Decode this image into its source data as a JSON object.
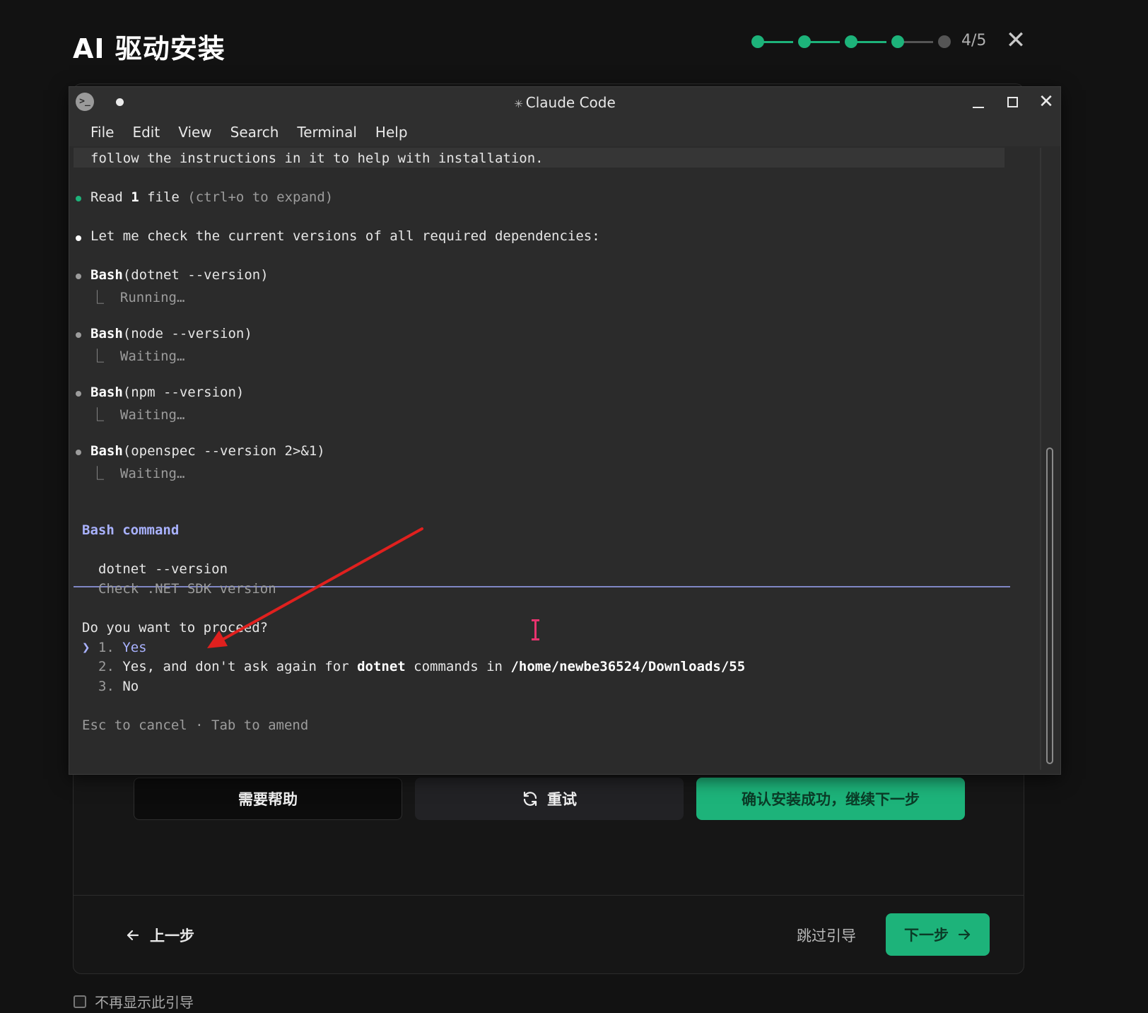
{
  "header": {
    "title": "AI 驱动安装",
    "step_counter": "4/5",
    "steps": [
      {
        "state": "done"
      },
      {
        "state": "done"
      },
      {
        "state": "done"
      },
      {
        "state": "current"
      },
      {
        "state": "pending"
      }
    ],
    "close_icon": "close-icon"
  },
  "terminal": {
    "window_title": "Claude Code",
    "menu": [
      "File",
      "Edit",
      "View",
      "Search",
      "Terminal",
      "Help"
    ],
    "lines": {
      "intro": "follow the instructions in it to help with installation.",
      "read_prefix": "Read ",
      "read_count": "1",
      "read_suffix": " file ",
      "read_hint": "(ctrl+o to expand)",
      "check": "Let me check the current versions of all required dependencies:",
      "bash_label": "Bash",
      "cmd1": "(dotnet --version)",
      "cmd1_status": "Running…",
      "cmd2": "(node --version)",
      "cmd2_status": "Waiting…",
      "cmd3": "(npm --version)",
      "cmd3_status": "Waiting…",
      "cmd4": "(openspec --version 2>&1)",
      "cmd4_status": "Waiting…"
    },
    "prompt": {
      "heading": "Bash command",
      "command": "dotnet --version",
      "description": "Check .NET SDK version",
      "question": "Do you want to proceed?",
      "selector": "❯",
      "option1_num": "1.",
      "option1": "Yes",
      "option2_num": "2.",
      "option2_a": "Yes, and don't ask again for ",
      "option2_cmd": "dotnet",
      "option2_b": " commands in ",
      "option2_path": "/home/newbe36524/Downloads/55",
      "option3_num": "3.",
      "option3": "No",
      "footer": "Esc to cancel · Tab to amend"
    }
  },
  "actions": {
    "help": "需要帮助",
    "retry": "重试",
    "confirm": "确认安装成功，继续下一步"
  },
  "footer": {
    "prev": "上一步",
    "skip": "跳过引导",
    "next": "下一步",
    "dont_show": "不再显示此引导"
  },
  "colors": {
    "accent": "#1db37a",
    "step_done": "#1db37a",
    "step_pending": "#555555",
    "prompt_purple": "#a9b2ff",
    "annotation_arrow": "#e0201e",
    "cursor": "#e8336e"
  }
}
